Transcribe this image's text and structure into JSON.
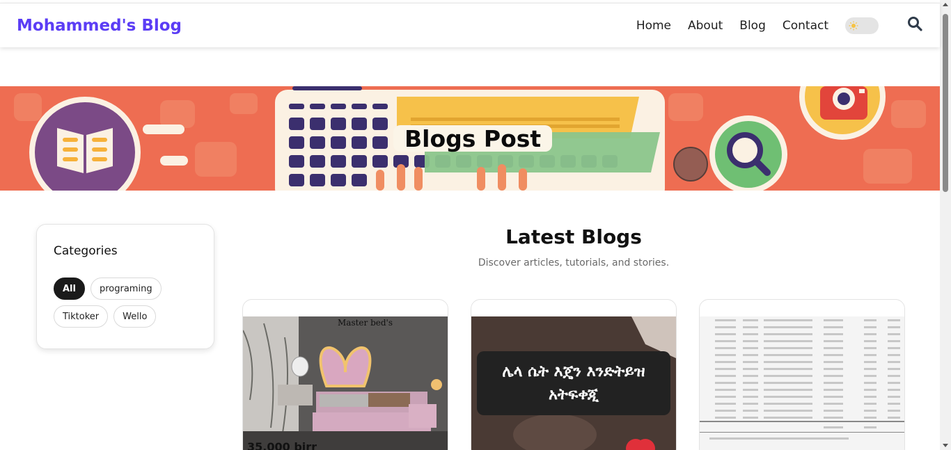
{
  "nav": {
    "brand": "Mohammed's Blog",
    "links": [
      "Home",
      "About",
      "Blog",
      "Contact"
    ],
    "theme_toggle_icon": "sun-icon",
    "search_icon": "search-icon"
  },
  "hero": {
    "title": "Blogs Post"
  },
  "sidebar": {
    "title": "Categories",
    "categories": [
      "All",
      "programing",
      "Tiktoker",
      "Wello"
    ],
    "active": "All"
  },
  "main": {
    "title": "Latest Blogs",
    "subtitle": "Discover articles, tutorials, and stories."
  },
  "cards": [
    {
      "image_brand_text": "Master bed's",
      "image_price_text": "35,000 birr"
    },
    {
      "image_caption": "ሌላ ሴት እጄን እንድትይዝ አትፍቀጂ"
    },
    {
      "image_desc": "spreadsheet-document"
    }
  ],
  "colors": {
    "brand": "#5b3df5",
    "hero_bg": "#ee6d52",
    "chip_active": "#1a1a1a"
  }
}
